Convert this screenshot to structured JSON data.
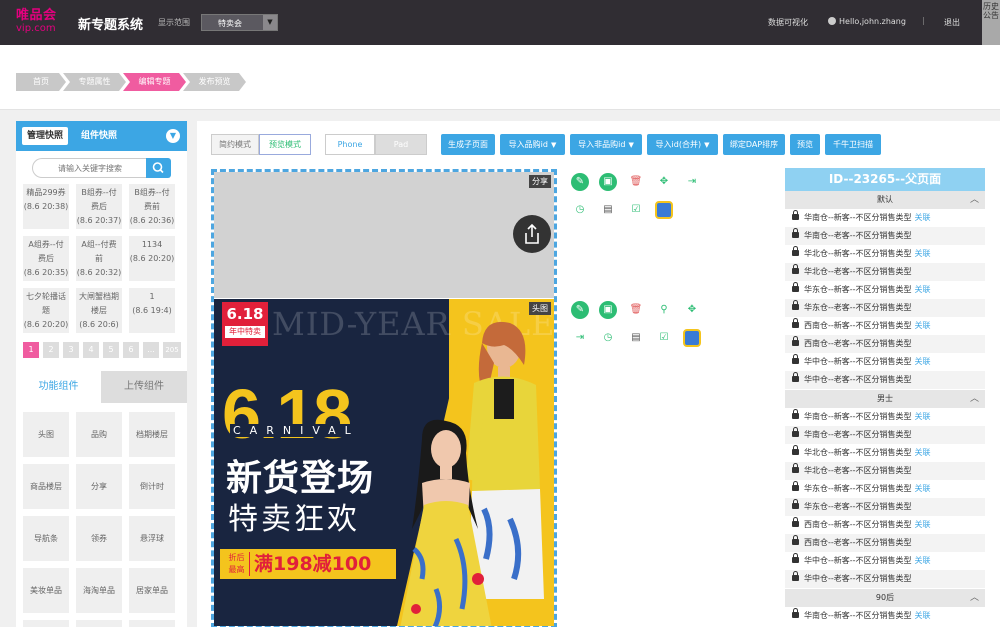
{
  "topbar": {
    "logo_top": "唯品会",
    "logo_bottom": "vip.com",
    "system_title": "新专题系统",
    "scope_label": "显示范围",
    "scope_value": "特卖会",
    "data_viz": "数据可视化",
    "hello": "Hello,john.zhang",
    "separator": "|",
    "logout": "退出",
    "history": "历史公告"
  },
  "steps": [
    "首页",
    "专题属性",
    "编辑专题",
    "发布预览"
  ],
  "left_panel": {
    "tab_manage": "管理快照",
    "tab_component": "组件快照",
    "search_placeholder": "请输入关键字搜索",
    "snapshots": [
      [
        "精品299券",
        "(8.6 20:38)"
      ],
      [
        "B组券--付",
        "费后",
        "(8.6 20:37)"
      ],
      [
        "B组券--付",
        "费前",
        "(8.6 20:36)"
      ],
      [
        "A组券--付",
        "费后",
        "(8.6 20:35)"
      ],
      [
        "A组--付费",
        "前",
        "(8.6 20:32)"
      ],
      [
        "1134",
        "(8.6 20:20)"
      ],
      [
        "七夕轮播话",
        "题",
        "(8.6 20:20)"
      ],
      [
        "大闸蟹档期",
        "楼层",
        "(8.6 20:6)"
      ],
      [
        "1",
        "(8.6 19:4)"
      ]
    ],
    "pages": [
      "1",
      "2",
      "3",
      "4",
      "5",
      "6",
      "...",
      "205"
    ],
    "tab_func": "功能组件",
    "tab_upload": "上传组件",
    "components": [
      "头图",
      "品购",
      "档期楼层",
      "商品楼层",
      "分享",
      "倒计时",
      "导航条",
      "领券",
      "悬浮球",
      "美妆单品",
      "海淘单品",
      "居家单品"
    ]
  },
  "toolbar": {
    "mode_simple": "简约模式",
    "mode_preview": "预览模式",
    "device_phone": "Phone",
    "device_pad": "Pad",
    "btn_gen_sub": "生成子页面",
    "btn_import_brand": "导入品购id",
    "btn_import_nonbrand": "导入非品购id",
    "btn_import_merge": "导入id(合并)",
    "btn_bind_dap": "绑定DAP排序",
    "btn_preview": "预览",
    "btn_scan": "千牛卫扫描"
  },
  "preview": {
    "tag_share": "分享",
    "tag_head": "头图",
    "badge_618": "6.18",
    "badge_sub": "年中特卖",
    "watermark": "MID-YEAR SALE",
    "big_618": "6.18",
    "carnival": "CARNIVAL",
    "headline1": "新货登场",
    "headline2": "特卖狂欢",
    "promo_small1": "折后",
    "promo_small2": "最高",
    "promo_text": "满198减100"
  },
  "right_panel": {
    "title": "ID--23265--父页面",
    "group_default": "默认",
    "group_male": "男士",
    "group_90": "90后",
    "link": "关联",
    "rows_default": [
      {
        "text": "华南仓--新客--不区分销售类型",
        "link": true
      },
      {
        "text": "华南仓--老客--不区分销售类型",
        "link": false
      },
      {
        "text": "华北仓--新客--不区分销售类型",
        "link": true
      },
      {
        "text": "华北仓--老客--不区分销售类型",
        "link": false
      },
      {
        "text": "华东仓--新客--不区分销售类型",
        "link": true
      },
      {
        "text": "华东仓--老客--不区分销售类型",
        "link": false
      },
      {
        "text": "西南仓--新客--不区分销售类型",
        "link": true
      },
      {
        "text": "西南仓--老客--不区分销售类型",
        "link": false
      },
      {
        "text": "华中仓--新客--不区分销售类型",
        "link": true
      },
      {
        "text": "华中仓--老客--不区分销售类型",
        "link": false
      }
    ],
    "rows_male": [
      {
        "text": "华南仓--新客--不区分销售类型",
        "link": true
      },
      {
        "text": "华南仓--老客--不区分销售类型",
        "link": false
      },
      {
        "text": "华北仓--新客--不区分销售类型",
        "link": true
      },
      {
        "text": "华北仓--老客--不区分销售类型",
        "link": false
      },
      {
        "text": "华东仓--新客--不区分销售类型",
        "link": true
      },
      {
        "text": "华东仓--老客--不区分销售类型",
        "link": false
      },
      {
        "text": "西南仓--新客--不区分销售类型",
        "link": true
      },
      {
        "text": "西南仓--老客--不区分销售类型",
        "link": false
      },
      {
        "text": "华中仓--新客--不区分销售类型",
        "link": true
      },
      {
        "text": "华中仓--老客--不区分销售类型",
        "link": false
      }
    ],
    "rows_90": [
      {
        "text": "华南仓--新客--不区分销售类型",
        "link": true
      }
    ]
  },
  "colors": {
    "topbar": "#302d33",
    "brand_pink": "#e4007f",
    "accent_blue": "#3ca6e4",
    "active_step": "#f05ca0",
    "icon_green": "#2dbd74",
    "banner_yellow": "#f4c41d"
  }
}
